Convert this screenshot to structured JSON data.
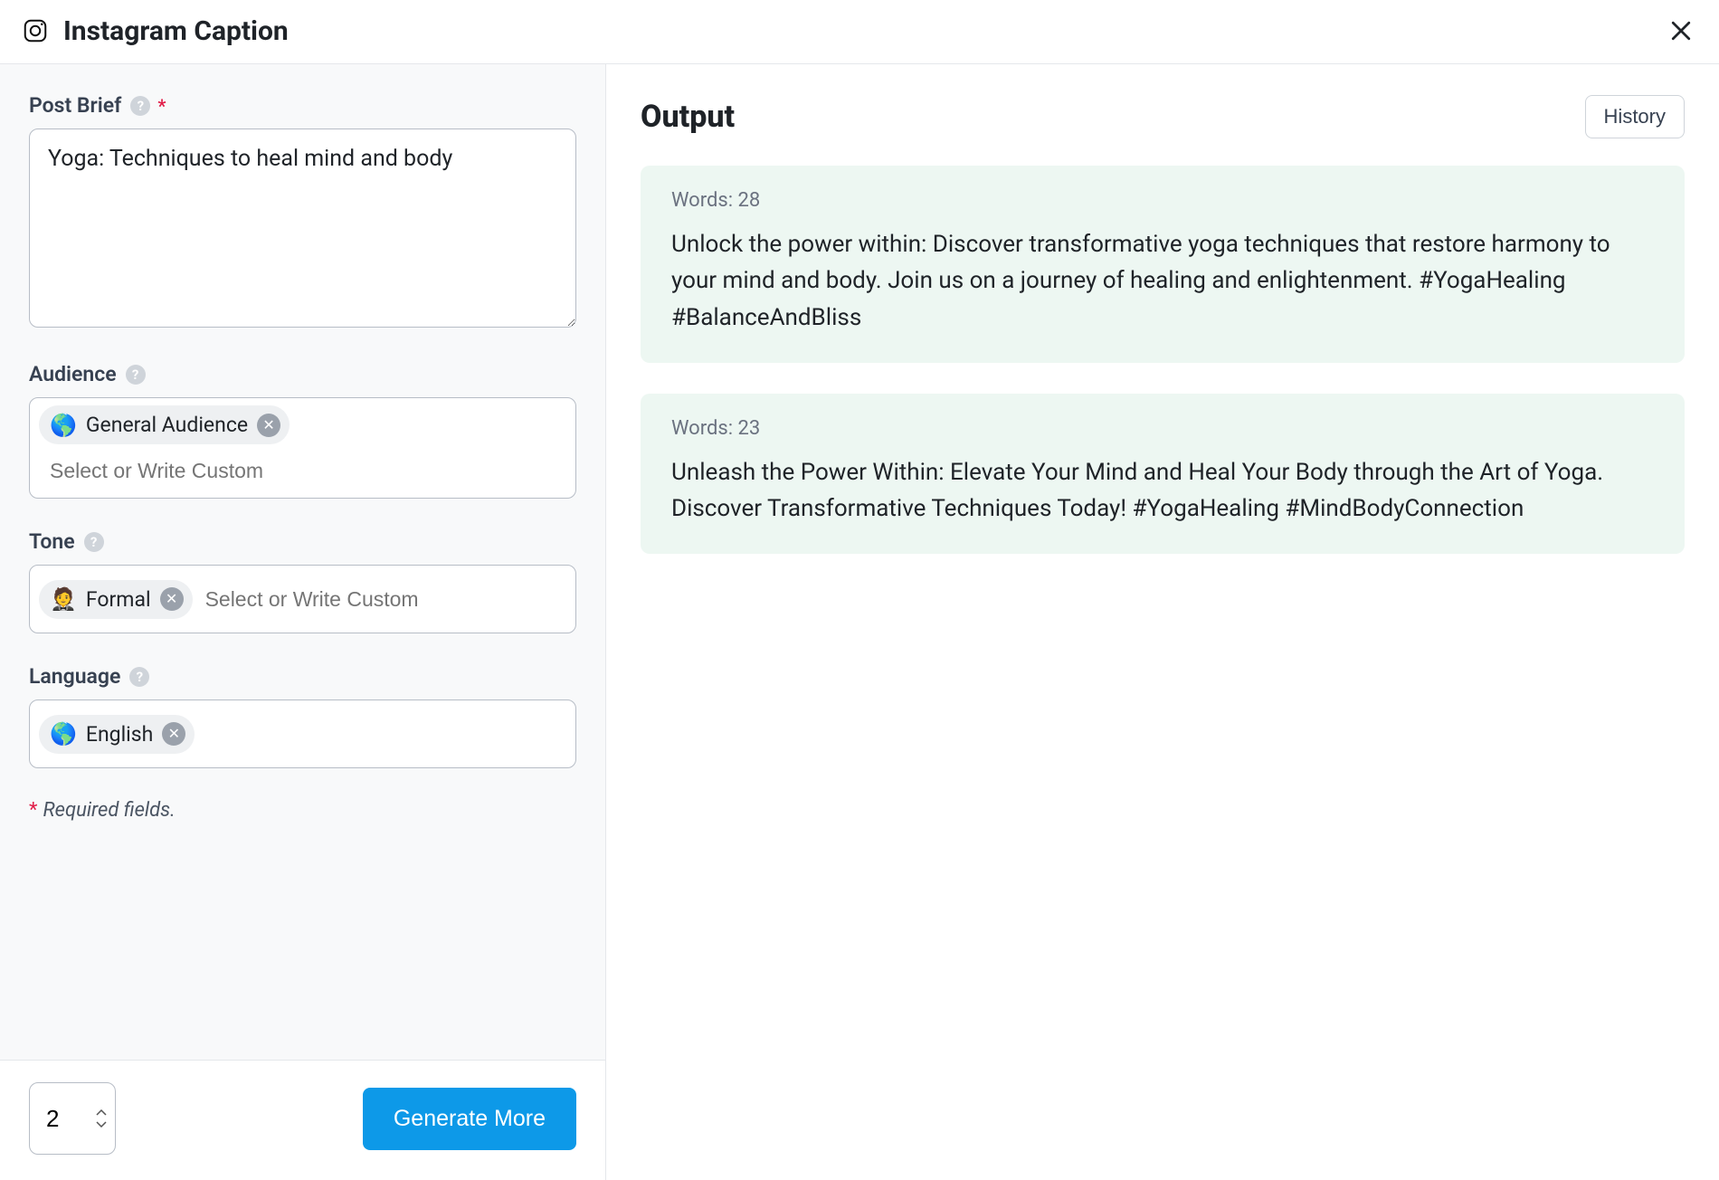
{
  "header": {
    "title": "Instagram Caption"
  },
  "form": {
    "post_brief": {
      "label": "Post Brief",
      "value": "Yoga: Techniques to heal mind and body",
      "required": true
    },
    "audience": {
      "label": "Audience",
      "chip_emoji": "🌎",
      "chip_label": "General Audience",
      "placeholder": "Select or Write Custom"
    },
    "tone": {
      "label": "Tone",
      "chip_emoji": "🤵",
      "chip_label": "Formal",
      "placeholder": "Select or Write Custom"
    },
    "language": {
      "label": "Language",
      "chip_emoji": "🌎",
      "chip_label": "English"
    },
    "required_note_prefix": "*",
    "required_note": "Required fields."
  },
  "footer": {
    "count_value": "2",
    "generate_label": "Generate More"
  },
  "output": {
    "title": "Output",
    "history_label": "History",
    "results": [
      {
        "words_label": "Words: 28",
        "text": "Unlock the power within: Discover transformative yoga techniques that restore harmony to your mind and body. Join us on a journey of healing and enlightenment. #YogaHealing #BalanceAndBliss"
      },
      {
        "words_label": "Words: 23",
        "text": "Unleash the Power Within: Elevate Your Mind and Heal Your Body through the Art of Yoga. Discover Transformative Techniques Today! #YogaHealing #MindBodyConnection"
      }
    ]
  }
}
